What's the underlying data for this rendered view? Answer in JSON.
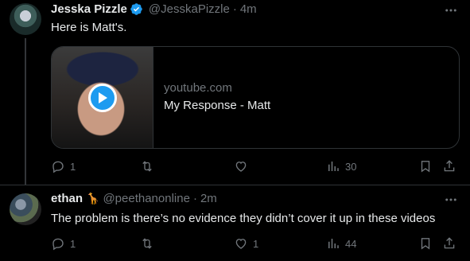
{
  "post1": {
    "display_name": "Jesska Pizzle",
    "handle": "@JesskaPizzle",
    "separator": "·",
    "time": "4m",
    "text": "Here is Matt's.",
    "card": {
      "domain": "youtube.com",
      "title": "My Response - Matt"
    },
    "metrics": {
      "replies": "1",
      "reposts": "",
      "likes": "",
      "views": "30"
    }
  },
  "post2": {
    "display_name": "ethan",
    "emoji": "🦒",
    "handle": "@peethanonline",
    "separator": "·",
    "time": "2m",
    "text": "The problem is there’s no evidence they didn’t cover it up in these videos",
    "metrics": {
      "replies": "1",
      "reposts": "",
      "likes": "1",
      "views": "44"
    }
  },
  "colors": {
    "accent": "#1d9bf0",
    "muted": "#71767b",
    "text": "#e7e9ea",
    "border": "#2f3336"
  }
}
